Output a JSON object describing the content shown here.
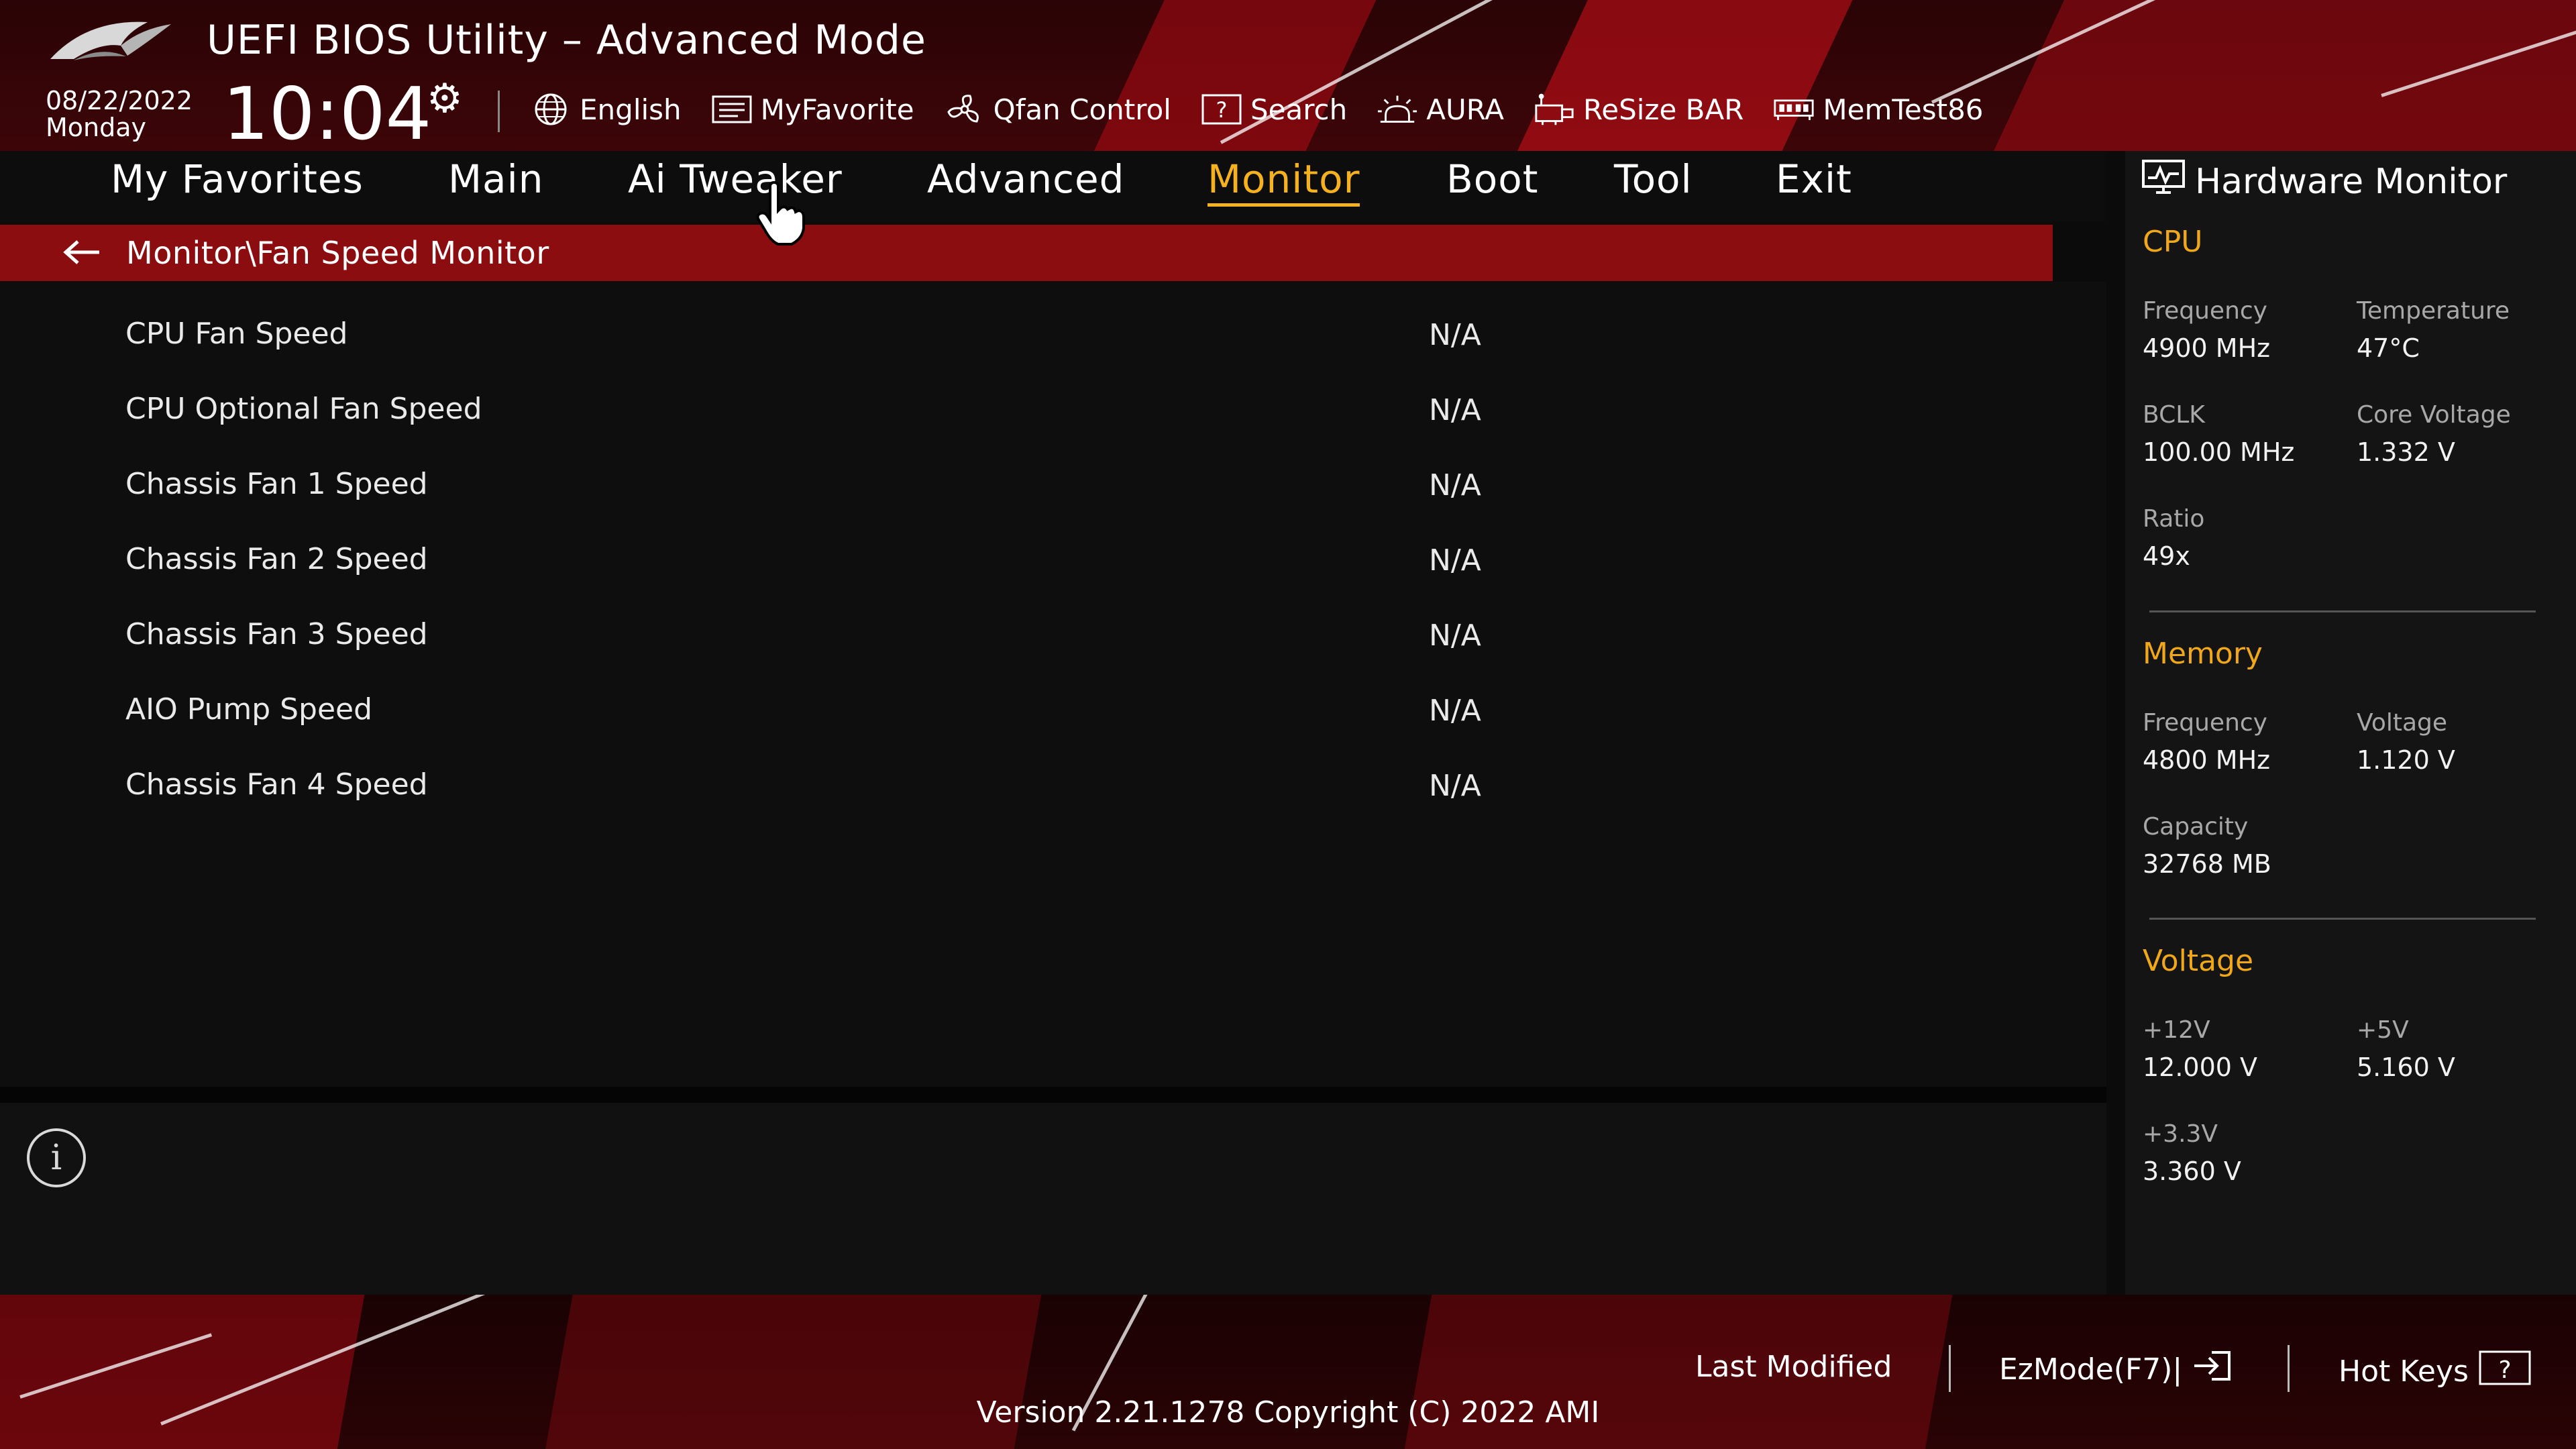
{
  "header": {
    "title": "UEFI BIOS Utility – Advanced Mode",
    "date": "08/22/2022",
    "day": "Monday",
    "time": "10:04",
    "toolbar": [
      {
        "label": "English",
        "icon": "globe-icon"
      },
      {
        "label": "MyFavorite",
        "icon": "favorite-icon"
      },
      {
        "label": "Qfan Control",
        "icon": "fan-icon"
      },
      {
        "label": "Search",
        "icon": "search-icon"
      },
      {
        "label": "AURA",
        "icon": "aura-icon"
      },
      {
        "label": "ReSize BAR",
        "icon": "resize-bar-icon"
      },
      {
        "label": "MemTest86",
        "icon": "memtest-icon"
      }
    ]
  },
  "nav": {
    "tabs": [
      "My Favorites",
      "Main",
      "Ai Tweaker",
      "Advanced",
      "Monitor",
      "Boot",
      "Tool",
      "Exit"
    ],
    "active": "Monitor"
  },
  "breadcrumb": "Monitor\\Fan Speed Monitor",
  "items": [
    {
      "label": "CPU Fan Speed",
      "value": "N/A"
    },
    {
      "label": "CPU Optional Fan Speed",
      "value": "N/A"
    },
    {
      "label": "Chassis Fan 1 Speed",
      "value": "N/A"
    },
    {
      "label": "Chassis Fan 2 Speed",
      "value": "N/A"
    },
    {
      "label": "Chassis Fan 3 Speed",
      "value": "N/A"
    },
    {
      "label": "AIO Pump Speed",
      "value": "N/A"
    },
    {
      "label": "Chassis Fan 4 Speed",
      "value": "N/A"
    }
  ],
  "hardware_monitor": {
    "title": "Hardware Monitor",
    "cpu": {
      "heading": "CPU",
      "frequency_label": "Frequency",
      "frequency": "4900 MHz",
      "temperature_label": "Temperature",
      "temperature": "47°C",
      "bclk_label": "BCLK",
      "bclk": "100.00 MHz",
      "core_voltage_label": "Core Voltage",
      "core_voltage": "1.332 V",
      "ratio_label": "Ratio",
      "ratio": "49x"
    },
    "memory": {
      "heading": "Memory",
      "frequency_label": "Frequency",
      "frequency": "4800 MHz",
      "voltage_label": "Voltage",
      "voltage": "1.120 V",
      "capacity_label": "Capacity",
      "capacity": "32768 MB"
    },
    "voltage": {
      "heading": "Voltage",
      "v12_label": "+12V",
      "v12": "12.000 V",
      "v5_label": "+5V",
      "v5": "5.160 V",
      "v33_label": "+3.3V",
      "v33": "3.360 V"
    }
  },
  "footer": {
    "last_modified": "Last Modified",
    "ezmode": "EzMode(F7)|",
    "hot_keys": "Hot Keys",
    "version": "Version 2.21.1278 Copyright (C) 2022 AMI"
  },
  "colors": {
    "accent": "#f5b21e",
    "section_heading": "#f0a81a",
    "breadcrumb_bg": "#8b0d10"
  }
}
